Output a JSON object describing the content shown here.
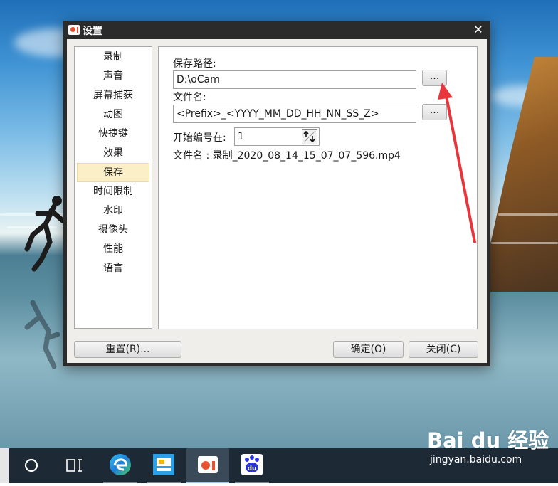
{
  "window": {
    "title": "设置",
    "close_symbol": "✕"
  },
  "sidebar": {
    "items": [
      {
        "label": "录制"
      },
      {
        "label": "声音"
      },
      {
        "label": "屏幕捕获"
      },
      {
        "label": "动图"
      },
      {
        "label": "快捷键"
      },
      {
        "label": "效果"
      },
      {
        "label": "保存",
        "selected": true
      },
      {
        "label": "时间限制"
      },
      {
        "label": "水印"
      },
      {
        "label": "摄像头"
      },
      {
        "label": "性能"
      },
      {
        "label": "语言"
      }
    ]
  },
  "save": {
    "path_label": "保存路径:",
    "path_value": "D:\\oCam",
    "browse_label": "...",
    "filename_label": "文件名:",
    "filename_value": "<Prefix>_<YYYY_MM_DD_HH_NN_SS_Z>",
    "start_label": "开始编号在:",
    "start_value": "1",
    "preview": "文件名 : 录制_2020_08_14_15_07_07_596.mp4"
  },
  "buttons": {
    "reset": "重置(R)...",
    "ok": "确定(O)",
    "close": "关闭(C)"
  },
  "colors": {
    "annotation_arrow": "#e8353b",
    "selected_item_bg": "#fbefc8"
  },
  "taskbar": {
    "items": [
      {
        "icon": "cortana-circle-icon"
      },
      {
        "icon": "task-view-icon"
      },
      {
        "icon": "edge-icon"
      },
      {
        "icon": "generic-app-icon"
      },
      {
        "icon": "ocam-icon",
        "active": true
      },
      {
        "icon": "baidu-icon"
      }
    ]
  },
  "watermark": {
    "brand": "Bai du 经验",
    "url": "jingyan.baidu.com"
  }
}
